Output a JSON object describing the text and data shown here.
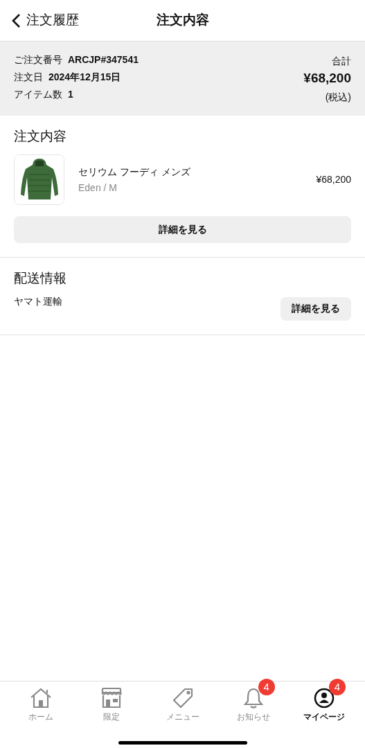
{
  "nav": {
    "back_label": "注文履歴",
    "title": "注文内容"
  },
  "summary": {
    "order_no_label": "ご注文番号",
    "order_no": "ARCJP#347541",
    "date_label": "注文日",
    "date": "2024年12月15日",
    "items_label": "アイテム数",
    "items": "1",
    "total_label": "合計",
    "total": "¥68,200",
    "tax_note": "(税込)"
  },
  "order_section": {
    "heading": "注文内容",
    "product": {
      "name": "セリウム フーディ メンズ",
      "variant": "Eden / M",
      "price": "¥68,200"
    },
    "button": "詳細を見る"
  },
  "shipping_section": {
    "heading": "配送情報",
    "carrier": "ヤマト運輸",
    "button": "詳細を見る"
  },
  "tab_bar": [
    {
      "kind": "home",
      "label": "ホーム",
      "selected": false
    },
    {
      "kind": "store",
      "label": "限定",
      "selected": false
    },
    {
      "kind": "tag",
      "label": "メニュー",
      "selected": false
    },
    {
      "kind": "bell",
      "label": "お知らせ",
      "selected": false,
      "badge": "4"
    },
    {
      "kind": "person",
      "label": "マイページ",
      "selected": true,
      "badge": "4"
    }
  ]
}
